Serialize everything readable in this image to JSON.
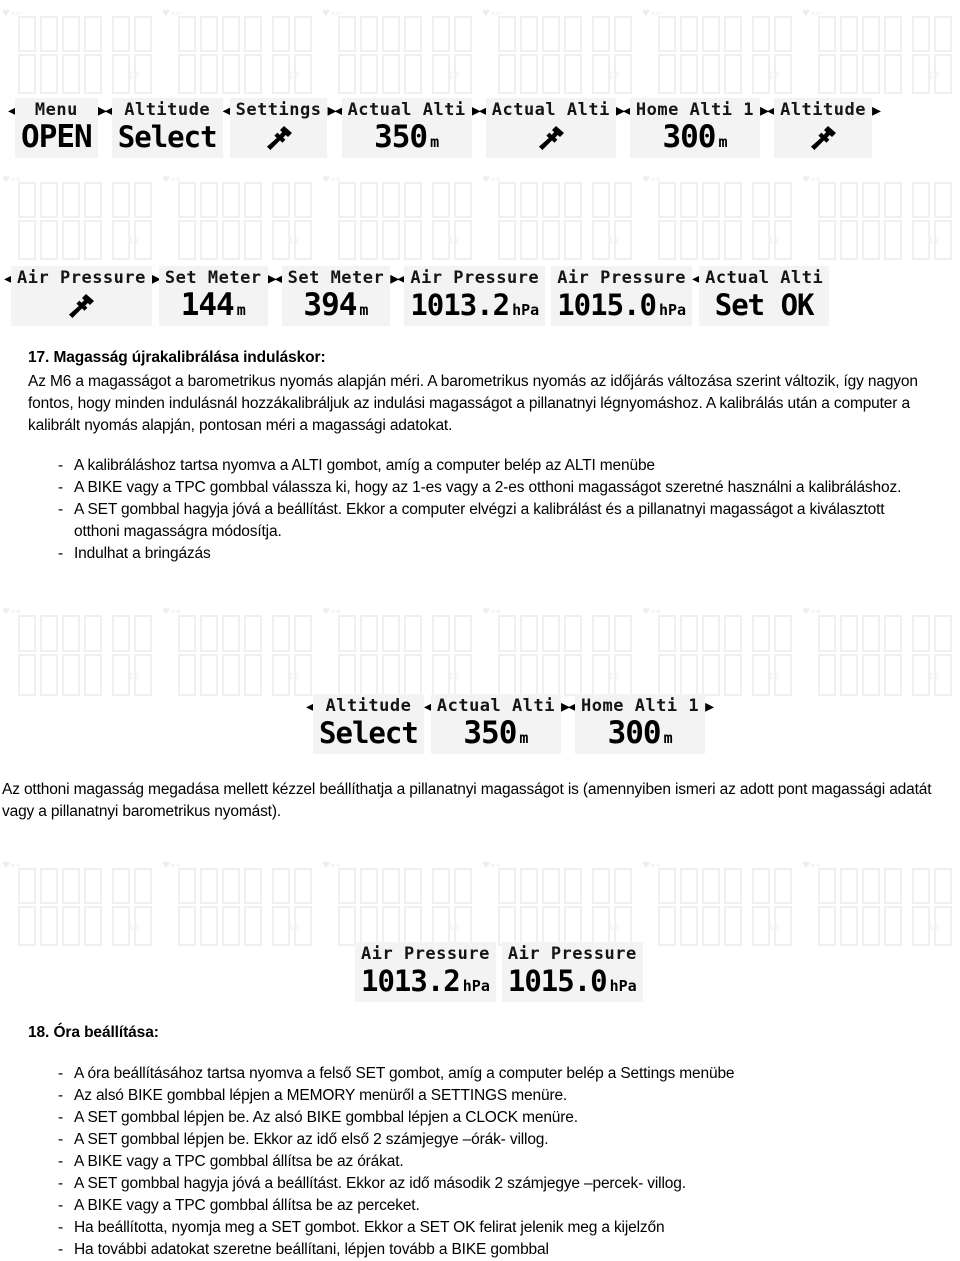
{
  "document": {
    "language": "hu",
    "background_watermark": "faint repeated LCD segment display pattern"
  },
  "lcd_rows": [
    {
      "name": "top-row-1",
      "screens": [
        {
          "lead_arrow": "◂",
          "title": "Menu",
          "value": "OPEN",
          "unit": "",
          "icon": "",
          "trail_arrow": "▸◂"
        },
        {
          "lead_arrow": "",
          "title": "Altitude",
          "value": "Select",
          "unit": "",
          "icon": "",
          "trail_arrow": "◂"
        },
        {
          "lead_arrow": "",
          "title": "Settings",
          "value": "",
          "unit": "",
          "icon": "wrench-icon",
          "trail_arrow": "▸◂"
        },
        {
          "lead_arrow": "",
          "title": "Actual Alti",
          "value": "350",
          "unit": "m",
          "icon": "",
          "trail_arrow": "▸◂"
        },
        {
          "lead_arrow": "",
          "title": "Actual Alti",
          "value": "",
          "unit": "",
          "icon": "wrench-icon",
          "trail_arrow": "▸◂"
        },
        {
          "lead_arrow": "",
          "title": "Home Alti 1",
          "value": "300",
          "unit": "m",
          "icon": "",
          "trail_arrow": "▸◂"
        },
        {
          "lead_arrow": "",
          "title": "Altitude",
          "value": "",
          "unit": "",
          "icon": "wrench-icon",
          "trail_arrow": "▸"
        }
      ]
    },
    {
      "name": "top-row-2",
      "screens": [
        {
          "lead_arrow": "◂",
          "title": "Air Pressure",
          "value": "",
          "unit": "",
          "icon": "wrench-icon",
          "trail_arrow": "▸"
        },
        {
          "lead_arrow": "",
          "title": "Set Meter",
          "value": "144",
          "unit": "m",
          "icon": "",
          "trail_arrow": "▸◂"
        },
        {
          "lead_arrow": "",
          "title": "Set Meter",
          "value": "394",
          "unit": "m",
          "icon": "",
          "trail_arrow": "▸◂"
        },
        {
          "lead_arrow": "",
          "title": "Air Pressure",
          "value": "1013.2",
          "unit": "hPa",
          "icon": "",
          "trail_arrow": ""
        },
        {
          "lead_arrow": "",
          "title": "Air Pressure",
          "value": "1015.0",
          "unit": "hPa",
          "icon": "",
          "trail_arrow": "◂"
        },
        {
          "lead_arrow": "",
          "title": "Actual Alti",
          "value": "Set OK",
          "unit": "",
          "icon": "",
          "trail_arrow": ""
        }
      ]
    },
    {
      "name": "middle-row",
      "screens": [
        {
          "lead_arrow": "◂",
          "title": "Altitude",
          "value": "Select",
          "unit": "",
          "icon": "",
          "trail_arrow": "◂"
        },
        {
          "lead_arrow": "",
          "title": "Actual Alti",
          "value": "350",
          "unit": "m",
          "icon": "",
          "trail_arrow": "▸◂"
        },
        {
          "lead_arrow": "",
          "title": "Home Alti 1",
          "value": "300",
          "unit": "m",
          "icon": "",
          "trail_arrow": "▸"
        }
      ]
    },
    {
      "name": "lower-row",
      "screens": [
        {
          "lead_arrow": "",
          "title": "Air Pressure",
          "value": "1013.2",
          "unit": "hPa",
          "icon": "",
          "trail_arrow": ""
        },
        {
          "lead_arrow": "",
          "title": "Air Pressure",
          "value": "1015.0",
          "unit": "hPa",
          "icon": "",
          "trail_arrow": ""
        }
      ]
    }
  ],
  "section17": {
    "heading": "17. Magasság újrakalibrálása induláskor:",
    "paragraph": "Az M6 a magasságot a barometrikus nyomás alapján méri. A barometrikus nyomás az időjárás változása szerint változik, így nagyon fontos, hogy minden indulásnál hozzákalibráljuk az indulási magasságot a pillanatnyi légnyomáshoz. A kalibrálás után a computer a kalibrált nyomás alapján, pontosan méri a magassági adatokat.",
    "dash": "-",
    "bullets": [
      "A kalibráláshoz tartsa nyomva a ALTI gombot, amíg a computer belép az ALTI menübe",
      "A BIKE vagy a TPC gombbal válassza ki, hogy az 1-es vagy a 2-es otthoni magasságot szeretné használni a kalibráláshoz.",
      "A SET gombbal hagyja jóvá a beállítást. Ekkor a computer elvégzi a kalibrálást és a pillanatnyi magasságot a kiválasztott otthoni magasságra módosítja.",
      "Indulhat a bringázás"
    ]
  },
  "note": {
    "text": "Az otthoni magasság megadása mellett kézzel beállíthatja a pillanatnyi magasságot is (amennyiben ismeri az adott pont magassági adatát vagy a pillanatnyi barometrikus nyomást)."
  },
  "section18": {
    "heading": "18. Óra beállítása:",
    "dash": "-",
    "bullets": [
      "A óra beállításához tartsa nyomva a felső SET gombot, amíg a computer belép a Settings menübe",
      "Az alsó BIKE gombbal lépjen a MEMORY menüről a SETTINGS menüre.",
      "A SET gombbal lépjen be. Az alsó BIKE gombbal lépjen a CLOCK menüre.",
      "A SET gombbal lépjen be. Ekkor az idő első 2 számjegye –órák- villog.",
      "A BIKE vagy a TPC gombbal állítsa be az órákat.",
      "A SET gombbal hagyja jóvá a beállítást. Ekkor az idő második 2 számjegye –percek- villog.",
      " A BIKE vagy a TPC gombbal állítsa be az perceket.",
      "Ha beállította, nyomja meg a SET gombot. Ekkor a SET OK felirat jelenik meg a kijelzőn",
      "Ha további adatokat szeretne beállítani, lépjen tovább a BIKE gombbal"
    ]
  },
  "colors": {
    "page_background": "#ffffff",
    "lcd_background": "#f3f3f3",
    "text": "#000000",
    "watermark": "#f1f1f1"
  }
}
